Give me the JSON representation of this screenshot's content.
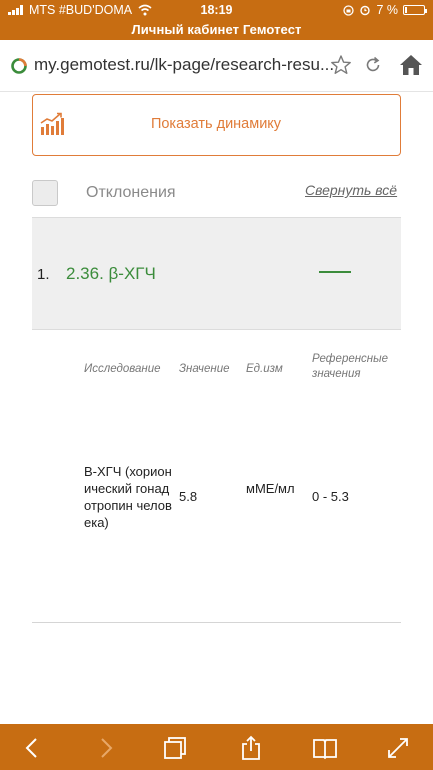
{
  "status_bar": {
    "carrier": "MTS #BUD'DOMA",
    "time": "18:19",
    "battery": "7 %"
  },
  "page_title": "Личный кабинет Гемотест",
  "browser": {
    "url": "my.gemotest.ru/lk-page/research-resu...",
    "icons": [
      "site-icon",
      "star-icon",
      "reload-icon",
      "home-icon"
    ]
  },
  "dynamics_button": {
    "label": "Показать динамику",
    "icon": "bar-chart-icon"
  },
  "deviations": {
    "label": "Отклонения",
    "collapse_label": "Свернуть всё"
  },
  "item": {
    "number": "1.",
    "name": "2.36. β-ХГЧ"
  },
  "table": {
    "headers": [
      "Исследование",
      "Значение",
      "Ед.изм",
      "Референсные значения"
    ],
    "rows": [
      [
        "В-ХГЧ (хорионический гонадотропин человека)",
        "5.8",
        "мМЕ/мл",
        "0 - 5.3"
      ]
    ]
  },
  "toolbar": {
    "icons": [
      "back-icon",
      "forward-icon",
      "tabs-icon",
      "share-icon",
      "bookmarks-icon",
      "fullscreen-icon"
    ]
  },
  "colors": {
    "accent_orange": "#c76d12",
    "button_orange": "#e07c39",
    "item_green": "#3b8c3b"
  }
}
